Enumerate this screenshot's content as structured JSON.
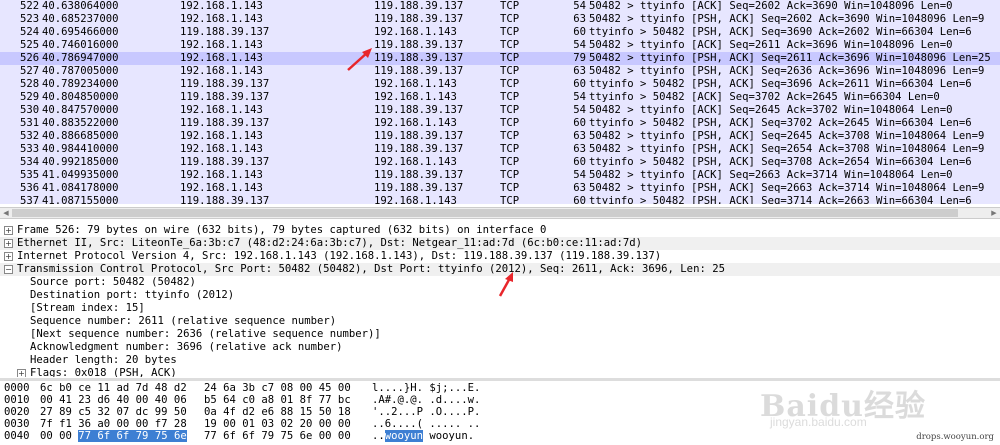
{
  "packets": [
    {
      "no": "522",
      "time": "40.638064000",
      "src": "192.168.1.143",
      "dst": "119.188.39.137",
      "proto": "TCP",
      "len": "54",
      "info": "50482 > ttyinfo [ACK] Seq=2602 Ack=3690 Win=1048096 Len=0",
      "sel": false
    },
    {
      "no": "523",
      "time": "40.685237000",
      "src": "192.168.1.143",
      "dst": "119.188.39.137",
      "proto": "TCP",
      "len": "63",
      "info": "50482 > ttyinfo [PSH, ACK] Seq=2602 Ack=3690 Win=1048096 Len=9",
      "sel": false
    },
    {
      "no": "524",
      "time": "40.695466000",
      "src": "119.188.39.137",
      "dst": "192.168.1.143",
      "proto": "TCP",
      "len": "60",
      "info": "ttyinfo > 50482 [PSH, ACK] Seq=3690 Ack=2602 Win=66304 Len=6",
      "sel": false
    },
    {
      "no": "525",
      "time": "40.746016000",
      "src": "192.168.1.143",
      "dst": "119.188.39.137",
      "proto": "TCP",
      "len": "54",
      "info": "50482 > ttyinfo [ACK] Seq=2611 Ack=3696 Win=1048096 Len=0",
      "sel": false
    },
    {
      "no": "526",
      "time": "40.786947000",
      "src": "192.168.1.143",
      "dst": "119.188.39.137",
      "proto": "TCP",
      "len": "79",
      "info": "50482 > ttyinfo [PSH, ACK] Seq=2611 Ack=3696 Win=1048096 Len=25",
      "sel": true
    },
    {
      "no": "527",
      "time": "40.787005000",
      "src": "192.168.1.143",
      "dst": "119.188.39.137",
      "proto": "TCP",
      "len": "63",
      "info": "50482 > ttyinfo [PSH, ACK] Seq=2636 Ack=3696 Win=1048096 Len=9",
      "sel": false
    },
    {
      "no": "528",
      "time": "40.789234000",
      "src": "119.188.39.137",
      "dst": "192.168.1.143",
      "proto": "TCP",
      "len": "60",
      "info": "ttyinfo > 50482 [PSH, ACK] Seq=3696 Ack=2611 Win=66304 Len=6",
      "sel": false
    },
    {
      "no": "529",
      "time": "40.804850000",
      "src": "119.188.39.137",
      "dst": "192.168.1.143",
      "proto": "TCP",
      "len": "54",
      "info": "ttyinfo > 50482 [ACK] Seq=3702 Ack=2645 Win=66304 Len=0",
      "sel": false
    },
    {
      "no": "530",
      "time": "40.847570000",
      "src": "192.168.1.143",
      "dst": "119.188.39.137",
      "proto": "TCP",
      "len": "54",
      "info": "50482 > ttyinfo [ACK] Seq=2645 Ack=3702 Win=1048064 Len=0",
      "sel": false
    },
    {
      "no": "531",
      "time": "40.883522000",
      "src": "119.188.39.137",
      "dst": "192.168.1.143",
      "proto": "TCP",
      "len": "60",
      "info": "ttyinfo > 50482 [PSH, ACK] Seq=3702 Ack=2645 Win=66304 Len=6",
      "sel": false
    },
    {
      "no": "532",
      "time": "40.886685000",
      "src": "192.168.1.143",
      "dst": "119.188.39.137",
      "proto": "TCP",
      "len": "63",
      "info": "50482 > ttyinfo [PSH, ACK] Seq=2645 Ack=3708 Win=1048064 Len=9",
      "sel": false
    },
    {
      "no": "533",
      "time": "40.984410000",
      "src": "192.168.1.143",
      "dst": "119.188.39.137",
      "proto": "TCP",
      "len": "63",
      "info": "50482 > ttyinfo [PSH, ACK] Seq=2654 Ack=3708 Win=1048064 Len=9",
      "sel": false
    },
    {
      "no": "534",
      "time": "40.992185000",
      "src": "119.188.39.137",
      "dst": "192.168.1.143",
      "proto": "TCP",
      "len": "60",
      "info": "ttyinfo > 50482 [PSH, ACK] Seq=3708 Ack=2654 Win=66304 Len=6",
      "sel": false
    },
    {
      "no": "535",
      "time": "41.049935000",
      "src": "192.168.1.143",
      "dst": "119.188.39.137",
      "proto": "TCP",
      "len": "54",
      "info": "50482 > ttyinfo [ACK] Seq=2663 Ack=3714 Win=1048064 Len=0",
      "sel": false
    },
    {
      "no": "536",
      "time": "41.084178000",
      "src": "192.168.1.143",
      "dst": "119.188.39.137",
      "proto": "TCP",
      "len": "63",
      "info": "50482 > ttyinfo [PSH, ACK] Seq=2663 Ack=3714 Win=1048064 Len=9",
      "sel": false
    },
    {
      "no": "537",
      "time": "41.087155000",
      "src": "119.188.39.137",
      "dst": "192.168.1.143",
      "proto": "TCP",
      "len": "60",
      "info": "ttyinfo > 50482 [PSH, ACK] Seq=3714 Ack=2663 Win=66304 Len=6",
      "sel": false
    }
  ],
  "details": [
    {
      "text": "Frame 526: 79 bytes on wire (632 bits), 79 bytes captured (632 bits) on interface 0",
      "toggle": "+",
      "child": false,
      "alt": false
    },
    {
      "text": "Ethernet II, Src: LiteonTe_6a:3b:c7 (48:d2:24:6a:3b:c7), Dst: Netgear_11:ad:7d (6c:b0:ce:11:ad:7d)",
      "toggle": "+",
      "child": false,
      "alt": true
    },
    {
      "text": "Internet Protocol Version 4, Src: 192.168.1.143 (192.168.1.143), Dst: 119.188.39.137 (119.188.39.137)",
      "toggle": "+",
      "child": false,
      "alt": false
    },
    {
      "text": "Transmission Control Protocol, Src Port: 50482 (50482), Dst Port: ttyinfo (2012), Seq: 2611, Ack: 3696, Len: 25",
      "toggle": "−",
      "child": false,
      "alt": true
    },
    {
      "text": "Source port: 50482 (50482)",
      "toggle": "",
      "child": true,
      "alt": false
    },
    {
      "text": "Destination port: ttyinfo (2012)",
      "toggle": "",
      "child": true,
      "alt": false
    },
    {
      "text": "[Stream index: 15]",
      "toggle": "",
      "child": true,
      "alt": false
    },
    {
      "text": "Sequence number: 2611    (relative sequence number)",
      "toggle": "",
      "child": true,
      "alt": false
    },
    {
      "text": "[Next sequence number: 2636    (relative sequence number)]",
      "toggle": "",
      "child": true,
      "alt": false
    },
    {
      "text": "Acknowledgment number: 3696    (relative ack number)",
      "toggle": "",
      "child": true,
      "alt": false
    },
    {
      "text": "Header length: 20 bytes",
      "toggle": "",
      "child": true,
      "alt": false
    },
    {
      "text": "Flags: 0x018 (PSH, ACK)",
      "toggle": "+",
      "child": true,
      "alt": false
    }
  ],
  "bytes": [
    {
      "off": "0000",
      "hex1": "6c b0 ce 11 ad 7d 48 d2",
      "hex2": "24 6a 3b c7 08 00 45 00",
      "ascii": "l....}H. $j;...E."
    },
    {
      "off": "0010",
      "hex1": "00 41 23 d6 40 00 40 06",
      "hex2": "b5 64 c0 a8 01 8f 77 bc",
      "ascii": ".A#.@.@. .d....w."
    },
    {
      "off": "0020",
      "hex1": "27 89 c5 32 07 dc 99 50",
      "hex2": "0a 4f d2 e6 88 15 50 18",
      "ascii": "'..2...P .O....P."
    },
    {
      "off": "0030",
      "hex1": "7f f1 36 a0 00 00 f7 28",
      "hex2": "19 00 01 03 02 20 00 00",
      "ascii": "..6....( ..... .."
    },
    {
      "off": "0040",
      "hex1_pre": "00 00 ",
      "hex1_hl": "77 6f 6f 79 75 6e",
      "hex2": "77 6f 6f 79 75 6e 00 00",
      "ascii_pre": "..",
      "ascii_hl": "wooyun",
      "ascii_post": " wooyun."
    }
  ],
  "watermark": {
    "text": "Baidu经验",
    "sub": "jingyan.baidu.com"
  },
  "site_credit": "drops.wooyun.org",
  "colors": {
    "list_bg": "#e7e6ff",
    "selected_row": "#c8c8ff",
    "byte_highlight": "#3d7fd3",
    "annotation_arrow": "#e8262b"
  }
}
